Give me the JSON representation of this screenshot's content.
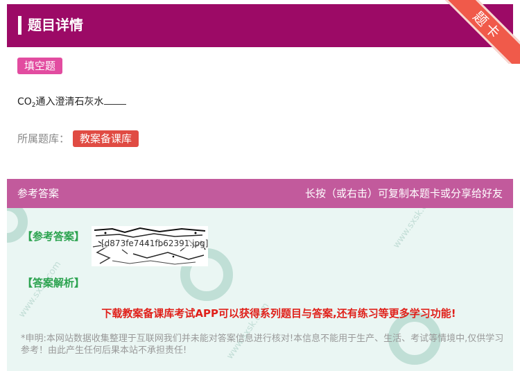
{
  "header": {
    "title": "题目详情"
  },
  "ribbon": {
    "label": "题卡"
  },
  "question": {
    "type_tag": "填空题",
    "text_prefix": "CO",
    "text_sub": "2",
    "text_suffix": "通入澄清石灰水"
  },
  "bank": {
    "label": "所属题库：",
    "name": "教案备课库"
  },
  "answer_header": {
    "left": "参考答案",
    "right": "长按（或右击）可复制本题卡或分享给好友"
  },
  "answer": {
    "answer_label": "【参考答案】",
    "image_filename": "[d873fe7441fb62391.jpg]",
    "explanation_label": "【答案解析】",
    "promo": "下载教案备课库考试APP可以获得系列题目与答案,还有练习等更多学习功能!",
    "disclaimer": "*申明:本网站数据收集整理于互联网我们并未能对答案信息进行核对!本信息不能用于生产、生活、考试等情境中,仅供学习参考！由此产生任何后果本站不承担责任!"
  },
  "colors": {
    "header_bg": "#9c0a66",
    "tag_bg": "#e24ca0",
    "bank_bg": "#e04b43",
    "answer_header_bg": "#c25a9c",
    "answer_bg": "#eaf6f3",
    "accent_green": "#2aa24e",
    "promo_red": "#e0201a"
  }
}
